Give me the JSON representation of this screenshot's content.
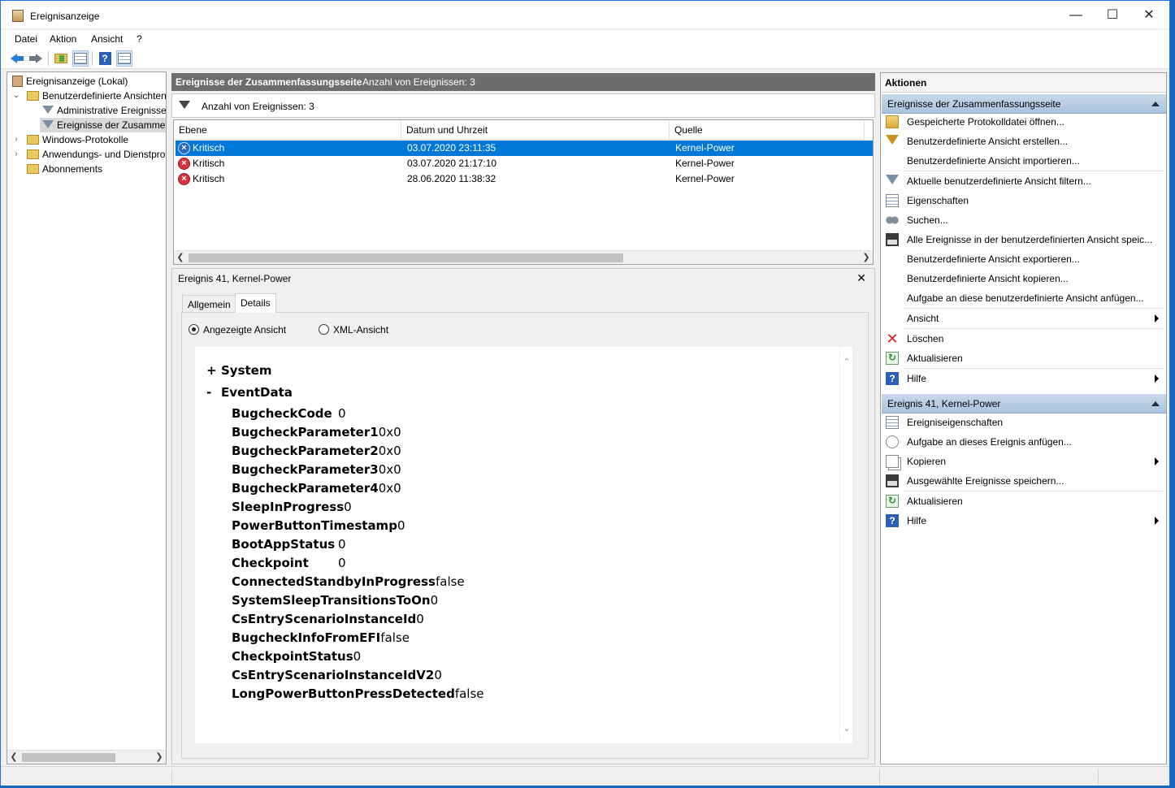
{
  "window": {
    "title": "Ereignisanzeige",
    "min_glyph": "—",
    "max_glyph": "☐",
    "close_glyph": "✕"
  },
  "menu": [
    "Datei",
    "Aktion",
    "Ansicht",
    "?"
  ],
  "tree": {
    "root": "Ereignisanzeige (Lokal)",
    "custom_views": "Benutzerdefinierte Ansichten",
    "admin_events": "Administrative Ereignisse",
    "summary_events": "Ereignisse der Zusammenfassungsseite",
    "windows_logs": "Windows-Protokolle",
    "app_logs": "Anwendungs- und Dienstprotokolle",
    "subscriptions": "Abonnements"
  },
  "main": {
    "header_title": "Ereignisse der Zusammenfassungsseite",
    "header_count": "Anzahl von Ereignissen: 3",
    "filter_text": "Anzahl von Ereignissen: 3",
    "columns": [
      "Ebene",
      "Datum und Uhrzeit",
      "Quelle"
    ],
    "events": [
      {
        "level": "Kritisch",
        "datetime": "03.07.2020 23:11:35",
        "source": "Kernel-Power"
      },
      {
        "level": "Kritisch",
        "datetime": "03.07.2020 21:17:10",
        "source": "Kernel-Power"
      },
      {
        "level": "Kritisch",
        "datetime": "28.06.2020 11:38:32",
        "source": "Kernel-Power"
      }
    ]
  },
  "details": {
    "title": "Ereignis 41, Kernel-Power",
    "close_glyph": "✕",
    "tabs": [
      "Allgemein",
      "Details"
    ],
    "active_tab": "Details",
    "radio_friendly": "Angezeigte Ansicht",
    "radio_xml": "XML-Ansicht",
    "system_toggle": "+",
    "system_label": "System",
    "eventdata_toggle": "-",
    "eventdata_label": "EventData",
    "fields": [
      {
        "key": "BugcheckCode",
        "value": "0"
      },
      {
        "key": "BugcheckParameter1",
        "value": "0x0"
      },
      {
        "key": "BugcheckParameter2",
        "value": "0x0"
      },
      {
        "key": "BugcheckParameter3",
        "value": "0x0"
      },
      {
        "key": "BugcheckParameter4",
        "value": "0x0"
      },
      {
        "key": "SleepInProgress",
        "value": "0"
      },
      {
        "key": "PowerButtonTimestamp",
        "value": "0"
      },
      {
        "key": "BootAppStatus",
        "value": "0"
      },
      {
        "key": "Checkpoint",
        "value": "0"
      },
      {
        "key": "ConnectedStandbyInProgress",
        "value": "false"
      },
      {
        "key": "SystemSleepTransitionsToOn",
        "value": "0"
      },
      {
        "key": "CsEntryScenarioInstanceId",
        "value": "0"
      },
      {
        "key": "BugcheckInfoFromEFI",
        "value": "false"
      },
      {
        "key": "CheckpointStatus",
        "value": "0"
      },
      {
        "key": "CsEntryScenarioInstanceIdV2",
        "value": "0"
      },
      {
        "key": "LongPowerButtonPressDetected",
        "value": "false"
      }
    ]
  },
  "actions": {
    "header": "Aktionen",
    "section1_title": "Ereignisse der Zusammenfassungsseite",
    "section1": [
      {
        "label": "Gespeicherte Protokolldatei öffnen...",
        "icon": "open-log-icon"
      },
      {
        "label": "Benutzerdefinierte Ansicht erstellen...",
        "icon": "create-view-icon"
      },
      {
        "label": "Benutzerdefinierte Ansicht importieren...",
        "icon": ""
      },
      {
        "label": "Aktuelle benutzerdefinierte Ansicht filtern...",
        "icon": "filter-icon"
      },
      {
        "label": "Eigenschaften",
        "icon": "properties-icon"
      },
      {
        "label": "Suchen...",
        "icon": "find-icon"
      },
      {
        "label": "Alle Ereignisse in der benutzerdefinierten Ansicht speic...",
        "icon": "save-icon"
      },
      {
        "label": "Benutzerdefinierte Ansicht exportieren...",
        "icon": ""
      },
      {
        "label": "Benutzerdefinierte Ansicht kopieren...",
        "icon": ""
      },
      {
        "label": "Aufgabe an diese benutzerdefinierte Ansicht anfügen...",
        "icon": ""
      },
      {
        "label": "Ansicht",
        "icon": "",
        "submenu": true
      },
      {
        "label": "Löschen",
        "icon": "delete-icon"
      },
      {
        "label": "Aktualisieren",
        "icon": "refresh-icon"
      },
      {
        "label": "Hilfe",
        "icon": "help-icon",
        "submenu": true
      }
    ],
    "section2_title": "Ereignis 41, Kernel-Power",
    "section2": [
      {
        "label": "Ereigniseigenschaften",
        "icon": "event-properties-icon"
      },
      {
        "label": "Aufgabe an dieses Ereignis anfügen...",
        "icon": "attach-task-icon"
      },
      {
        "label": "Kopieren",
        "icon": "copy-icon",
        "submenu": true
      },
      {
        "label": "Ausgewählte Ereignisse speichern...",
        "icon": "save-icon"
      },
      {
        "label": "Aktualisieren",
        "icon": "refresh-icon"
      },
      {
        "label": "Hilfe",
        "icon": "help-icon",
        "submenu": true
      }
    ]
  },
  "colors": {
    "selection": "#0078d7",
    "section_header": "#b9cde3",
    "critical": "#d8323c"
  }
}
